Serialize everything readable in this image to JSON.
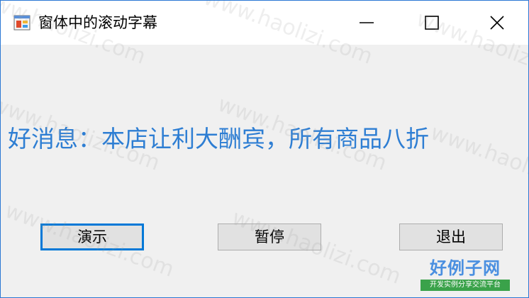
{
  "window": {
    "title": "窗体中的滚动字幕",
    "icon": "app-form-icon",
    "accent_color": "#2b78d4"
  },
  "caption_buttons": {
    "minimize_icon": "minimize-icon",
    "maximize_icon": "maximize-icon",
    "close_icon": "close-icon"
  },
  "marquee": {
    "text": "好消息：本店让利大酬宾，所有商品八折",
    "color": "#2e7ed3"
  },
  "buttons": {
    "demo_label": "演示",
    "pause_label": "暂停",
    "exit_label": "退出",
    "focus_color": "#0078d7"
  },
  "watermark": {
    "text": "www.haolizi.com"
  },
  "logo": {
    "main": "好例子网",
    "sub": "开发实例分享交流平台"
  }
}
